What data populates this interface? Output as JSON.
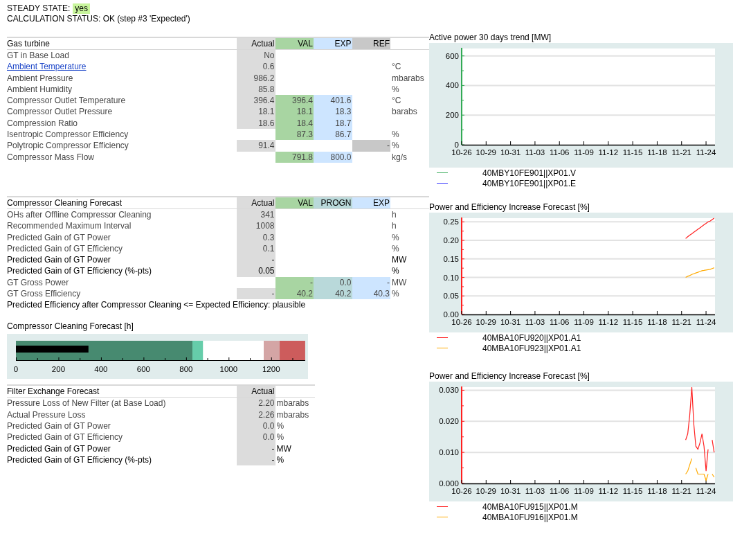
{
  "steady_state": {
    "label": "STEADY STATE:",
    "value": "yes"
  },
  "calculation_status": "CALCULATION STATUS: OK (step #3 'Expected')",
  "gas_turbine": {
    "title": "Gas turbine",
    "columns": [
      {
        "label": "Actual",
        "kind": "actual"
      },
      {
        "label": "VAL",
        "kind": "val"
      },
      {
        "label": "EXP",
        "kind": "exp"
      },
      {
        "label": "REF",
        "kind": "ref"
      }
    ],
    "rows": [
      {
        "label": "GT in Base Load",
        "link": false,
        "emphasized": false,
        "values": {
          "actual": "No"
        }
      },
      {
        "label": "Ambient Temperature",
        "link": true,
        "emphasized": false,
        "values": {
          "actual": "0.6"
        },
        "unit": "°C"
      },
      {
        "label": "Ambient Pressure",
        "link": false,
        "emphasized": false,
        "values": {
          "actual": "986.2"
        },
        "unit": "mbarabs"
      },
      {
        "label": "Ambient Humidity",
        "link": false,
        "emphasized": false,
        "values": {
          "actual": "85.8"
        },
        "unit": "%"
      },
      {
        "label": "Compressor Outlet Temperature",
        "link": false,
        "emphasized": false,
        "values": {
          "actual": "396.4",
          "val": "396.4",
          "exp": "401.6"
        },
        "unit": "°C"
      },
      {
        "label": "Compressor Outlet Pressure",
        "link": false,
        "emphasized": false,
        "values": {
          "actual": "18.1",
          "val": "18.1",
          "exp": "18.3"
        },
        "unit": "barabs"
      },
      {
        "label": "Compression Ratio",
        "link": false,
        "emphasized": false,
        "values": {
          "actual": "18.6",
          "val": "18.4",
          "exp": "18.7"
        }
      },
      {
        "label": "Isentropic Compressor Efficiency",
        "link": false,
        "emphasized": false,
        "values": {
          "val": "87.3",
          "exp": "86.7"
        },
        "unit": "%"
      },
      {
        "label": "Polytropic Compressor Efficiency",
        "link": false,
        "emphasized": false,
        "values": {
          "actual": "91.4",
          "ref": "-"
        },
        "unit": "%"
      },
      {
        "label": "Compressor Mass Flow",
        "link": false,
        "emphasized": false,
        "values": {
          "val": "791.8",
          "exp": "800.0"
        },
        "unit": "kg/s"
      }
    ]
  },
  "compressor_cleaning": {
    "title": "Compressor Cleaning Forecast",
    "columns": [
      {
        "label": "Actual",
        "kind": "actual"
      },
      {
        "label": "VAL",
        "kind": "val"
      },
      {
        "label": "PROGN",
        "kind": "progn"
      },
      {
        "label": "EXP",
        "kind": "exp"
      }
    ],
    "rows": [
      {
        "label": "OHs after Offline Compressor Cleaning",
        "emphasized": false,
        "values": {
          "actual": "341"
        },
        "unit": "h"
      },
      {
        "label": "Recommended Maximum Interval",
        "emphasized": false,
        "values": {
          "actual": "1008"
        },
        "unit": "h"
      },
      {
        "label": "Predicted Gain of GT Power",
        "emphasized": false,
        "values": {
          "actual": "0.3"
        },
        "unit": "%"
      },
      {
        "label": "Predicted Gain of GT Efficiency",
        "emphasized": false,
        "values": {
          "actual": "0.1"
        },
        "unit": "%"
      },
      {
        "label": "Predicted Gain of GT Power",
        "emphasized": true,
        "values": {
          "actual": "-"
        },
        "unit": "MW"
      },
      {
        "label": "Predicted Gain of GT Efficiency (%-pts)",
        "emphasized": true,
        "values": {
          "actual": "0.05"
        },
        "unit": "%"
      },
      {
        "label": "GT Gross Power",
        "emphasized": false,
        "values": {
          "val": "-",
          "progn": "0.0",
          "exp": "-"
        },
        "unit": "MW"
      },
      {
        "label": "GT Gross Efficiency",
        "emphasized": false,
        "values": {
          "actual": "-",
          "val": "40.2",
          "progn": "40.2",
          "exp": "40.3"
        },
        "unit": "%"
      }
    ],
    "note": "Predicted Efficiency after Compressor Cleaning <= Expected Efficiency: plausible"
  },
  "cleaning_forecast_chart": {
    "chart_data": {
      "type": "bar",
      "orientation": "horizontal",
      "title": "Compressor Cleaning Forecast [h]",
      "xlim": [
        0,
        1360
      ],
      "xticks": [
        0,
        200,
        400,
        600,
        800,
        1000,
        1200
      ],
      "series": [
        {
          "color": "#000000",
          "values": [
            341
          ]
        }
      ]
    }
  },
  "filter_exchange": {
    "title": "Filter Exchange Forecast",
    "columns": [
      {
        "label": "Actual",
        "kind": "actual"
      }
    ],
    "rows": [
      {
        "label": "Pressure Loss of New Filter (at Base Load)",
        "emphasized": false,
        "values": {
          "actual": "2.20"
        },
        "unit": "mbarabs"
      },
      {
        "label": "Actual Pressure Loss",
        "emphasized": false,
        "values": {
          "actual": "2.26"
        },
        "unit": "mbarabs"
      },
      {
        "label": "Predicted Gain of GT Power",
        "emphasized": false,
        "values": {
          "actual": "0.0"
        },
        "unit": "%"
      },
      {
        "label": "Predicted Gain of GT Efficiency",
        "emphasized": false,
        "values": {
          "actual": "0.0"
        },
        "unit": "%"
      },
      {
        "label": "Predicted Gain of GT Power",
        "emphasized": true,
        "values": {
          "actual": "-"
        },
        "unit": "MW"
      },
      {
        "label": "Predicted Gain of GT Efficiency (%-pts)",
        "emphasized": true,
        "values": {
          "actual": "-"
        },
        "unit": "%"
      }
    ]
  },
  "trend_charts": [
    {
      "chart_data": {
        "type": "line",
        "title": "Active power 30 days trend [MW]",
        "grid": true,
        "ylim": [
          0,
          650
        ],
        "yticks": [
          0,
          200,
          400,
          600
        ],
        "categories": [
          "10-26",
          null,
          null,
          null,
          null,
          null,
          null,
          null,
          null,
          null,
          null,
          null,
          "10-29",
          null,
          null,
          null,
          null,
          null,
          null,
          null,
          null,
          null,
          null,
          null,
          "10-31",
          null,
          null,
          null,
          null,
          null,
          null,
          null,
          null,
          null,
          null,
          null,
          "11-03",
          null,
          null,
          null,
          null,
          null,
          null,
          null,
          null,
          null,
          null,
          null,
          "11-06",
          null,
          null,
          null,
          null,
          null,
          null,
          null,
          null,
          null,
          null,
          null,
          "11-09",
          null,
          null,
          null,
          null,
          null,
          null,
          null,
          null,
          null,
          null,
          null,
          "11-12",
          null,
          null,
          null,
          null,
          null,
          null,
          null,
          null,
          null,
          null,
          null,
          "11-15",
          null,
          null,
          null,
          null,
          null,
          null,
          null,
          null,
          null,
          null,
          null,
          "11-18",
          null,
          null,
          null,
          null,
          null,
          null,
          null,
          null,
          null,
          null,
          null,
          "11-21",
          null,
          null,
          null,
          null,
          null,
          null,
          null,
          null,
          null,
          null,
          null,
          "11-24",
          null,
          null,
          null,
          null
        ],
        "series": [
          {
            "name": "40MBY10FE901||XP01.V",
            "color": "#33aa55",
            "values": [
              null,
              null,
              null,
              null,
              null,
              null,
              null,
              null,
              null,
              null,
              null,
              null,
              null,
              null,
              null,
              null,
              null,
              null,
              null,
              null,
              null,
              null,
              null,
              null,
              null,
              null,
              null,
              null,
              null,
              null,
              null,
              null,
              null,
              null,
              null,
              null,
              null,
              null,
              null,
              null,
              null,
              null,
              null,
              null,
              null,
              null,
              null,
              null,
              null,
              null,
              null,
              null,
              null,
              null,
              null,
              null,
              null,
              null,
              null,
              null,
              null,
              null,
              null,
              null,
              null,
              null,
              null,
              null,
              null,
              null,
              null,
              null,
              null,
              null,
              null,
              null,
              null,
              null,
              null,
              null,
              null,
              null,
              null,
              null,
              null,
              null,
              null,
              null,
              null,
              null,
              null,
              null,
              null,
              null,
              null,
              null,
              null,
              null,
              null,
              null,
              null,
              null,
              null,
              null,
              null,
              null,
              null,
              null,
              null,
              null,
              null,
              null,
              null,
              null,
              null,
              null,
              null,
              null,
              null,
              null,
              null,
              null,
              null,
              null,
              null
            ]
          },
          {
            "name": "40MBY10FE901||XP01.E",
            "color": "#3333ff",
            "values": [
              null,
              null,
              null,
              null,
              null,
              null,
              null,
              null,
              null,
              null,
              null,
              null,
              null,
              null,
              null,
              null,
              null,
              null,
              null,
              null,
              null,
              null,
              null,
              null,
              null,
              null,
              null,
              null,
              null,
              null,
              null,
              null,
              null,
              null,
              null,
              null,
              null,
              null,
              null,
              null,
              null,
              null,
              null,
              null,
              null,
              null,
              null,
              null,
              null,
              null,
              null,
              null,
              null,
              null,
              null,
              null,
              null,
              null,
              null,
              null,
              null,
              null,
              null,
              null,
              null,
              null,
              null,
              null,
              null,
              null,
              null,
              null,
              null,
              null,
              null,
              null,
              null,
              null,
              null,
              null,
              null,
              null,
              null,
              null,
              null,
              null,
              null,
              null,
              null,
              null,
              null,
              null,
              null,
              null,
              null,
              null,
              null,
              null,
              null,
              null,
              null,
              null,
              null,
              null,
              null,
              null,
              null,
              null,
              null,
              null,
              null,
              null,
              null,
              null,
              null,
              null,
              null,
              null,
              null,
              null,
              null,
              null,
              null,
              null,
              null
            ]
          }
        ]
      }
    },
    {
      "chart_data": {
        "type": "line",
        "title": "Power and Efficiency Increase Forecast [%]",
        "grid": true,
        "ylim": [
          0,
          0.26
        ],
        "yticks": [
          {
            "value": 0,
            "label": "0.00"
          },
          {
            "value": 0.05,
            "label": "0.05"
          },
          {
            "value": 0.1,
            "label": "0.10"
          },
          {
            "value": 0.15,
            "label": "0.15"
          },
          {
            "value": 0.2,
            "label": "0.20"
          },
          {
            "value": 0.25,
            "label": "0.25"
          }
        ],
        "categories": [
          "10-26",
          null,
          null,
          null,
          null,
          null,
          null,
          null,
          null,
          null,
          null,
          null,
          "10-29",
          null,
          null,
          null,
          null,
          null,
          null,
          null,
          null,
          null,
          null,
          null,
          "10-31",
          null,
          null,
          null,
          null,
          null,
          null,
          null,
          null,
          null,
          null,
          null,
          "11-03",
          null,
          null,
          null,
          null,
          null,
          null,
          null,
          null,
          null,
          null,
          null,
          "11-06",
          null,
          null,
          null,
          null,
          null,
          null,
          null,
          null,
          null,
          null,
          null,
          "11-09",
          null,
          null,
          null,
          null,
          null,
          null,
          null,
          null,
          null,
          null,
          null,
          "11-12",
          null,
          null,
          null,
          null,
          null,
          null,
          null,
          null,
          null,
          null,
          null,
          "11-15",
          null,
          null,
          null,
          null,
          null,
          null,
          null,
          null,
          null,
          null,
          null,
          "11-18",
          null,
          null,
          null,
          null,
          null,
          null,
          null,
          null,
          null,
          null,
          null,
          "11-21",
          null,
          null,
          null,
          null,
          null,
          null,
          null,
          null,
          null,
          null,
          null,
          "11-24",
          null,
          null,
          null,
          null
        ],
        "series": [
          {
            "name": "40MBA10FU920||XP01.A1",
            "color": "#ff2020",
            "values": [
              null,
              null,
              null,
              null,
              null,
              null,
              null,
              null,
              null,
              null,
              null,
              null,
              null,
              null,
              null,
              null,
              null,
              null,
              null,
              null,
              null,
              null,
              null,
              null,
              null,
              null,
              null,
              null,
              null,
              null,
              null,
              null,
              null,
              null,
              null,
              null,
              null,
              null,
              null,
              null,
              null,
              null,
              null,
              null,
              null,
              null,
              null,
              null,
              null,
              null,
              null,
              null,
              null,
              null,
              null,
              null,
              null,
              null,
              null,
              null,
              null,
              null,
              null,
              null,
              null,
              null,
              null,
              null,
              null,
              null,
              null,
              null,
              null,
              null,
              null,
              null,
              null,
              null,
              null,
              null,
              null,
              null,
              null,
              null,
              null,
              null,
              null,
              null,
              null,
              null,
              null,
              null,
              null,
              null,
              null,
              null,
              null,
              null,
              null,
              null,
              null,
              null,
              null,
              null,
              null,
              null,
              null,
              null,
              null,
              null,
              0.205,
              0.21,
              0.214,
              0.218,
              0.222,
              0.226,
              0.23,
              0.234,
              0.238,
              0.242,
              0.246,
              0.25,
              0.252,
              0.256,
              0.26
            ]
          },
          {
            "name": "40MBA10FU923||XP01.A1",
            "color": "#ffaa00",
            "values": [
              null,
              null,
              null,
              null,
              null,
              null,
              null,
              null,
              null,
              null,
              null,
              null,
              null,
              null,
              null,
              null,
              null,
              null,
              null,
              null,
              null,
              null,
              null,
              null,
              null,
              null,
              null,
              null,
              null,
              null,
              null,
              null,
              null,
              null,
              null,
              null,
              null,
              null,
              null,
              null,
              null,
              null,
              null,
              null,
              null,
              null,
              null,
              null,
              null,
              null,
              null,
              null,
              null,
              null,
              null,
              null,
              null,
              null,
              null,
              null,
              null,
              null,
              null,
              null,
              null,
              null,
              null,
              null,
              null,
              null,
              null,
              null,
              null,
              null,
              null,
              null,
              null,
              null,
              null,
              null,
              null,
              null,
              null,
              null,
              null,
              null,
              null,
              null,
              null,
              null,
              null,
              null,
              null,
              null,
              null,
              null,
              null,
              null,
              null,
              null,
              null,
              null,
              null,
              null,
              null,
              null,
              null,
              null,
              null,
              null,
              0.1,
              0.103,
              0.105,
              0.108,
              0.11,
              0.112,
              0.114,
              0.116,
              0.118,
              0.119,
              0.12,
              0.121,
              0.122,
              0.124,
              0.126
            ]
          }
        ]
      }
    },
    {
      "chart_data": {
        "type": "line",
        "title": "Power and Efficiency Increase Forecast [%]",
        "grid": true,
        "ylim": [
          0,
          0.031
        ],
        "yticks": [
          {
            "value": 0,
            "label": "0.000"
          },
          {
            "value": 0.01,
            "label": "0.010"
          },
          {
            "value": 0.02,
            "label": "0.020"
          },
          {
            "value": 0.03,
            "label": "0.030"
          }
        ],
        "categories": [
          "10-26",
          null,
          null,
          null,
          null,
          null,
          null,
          null,
          null,
          null,
          null,
          null,
          "10-29",
          null,
          null,
          null,
          null,
          null,
          null,
          null,
          null,
          null,
          null,
          null,
          "10-31",
          null,
          null,
          null,
          null,
          null,
          null,
          null,
          null,
          null,
          null,
          null,
          "11-03",
          null,
          null,
          null,
          null,
          null,
          null,
          null,
          null,
          null,
          null,
          null,
          "11-06",
          null,
          null,
          null,
          null,
          null,
          null,
          null,
          null,
          null,
          null,
          null,
          "11-09",
          null,
          null,
          null,
          null,
          null,
          null,
          null,
          null,
          null,
          null,
          null,
          "11-12",
          null,
          null,
          null,
          null,
          null,
          null,
          null,
          null,
          null,
          null,
          null,
          "11-15",
          null,
          null,
          null,
          null,
          null,
          null,
          null,
          null,
          null,
          null,
          null,
          "11-18",
          null,
          null,
          null,
          null,
          null,
          null,
          null,
          null,
          null,
          null,
          null,
          "11-21",
          null,
          null,
          null,
          null,
          null,
          null,
          null,
          null,
          null,
          null,
          null,
          "11-24",
          null,
          null,
          null,
          null
        ],
        "series": [
          {
            "name": "40MBA10FU915||XP01.M",
            "color": "#ff2020",
            "values": [
              null,
              null,
              null,
              null,
              null,
              null,
              null,
              null,
              null,
              null,
              null,
              null,
              null,
              null,
              null,
              null,
              null,
              null,
              null,
              null,
              null,
              null,
              null,
              null,
              null,
              null,
              null,
              null,
              null,
              null,
              null,
              null,
              null,
              null,
              null,
              null,
              null,
              null,
              null,
              null,
              null,
              null,
              null,
              null,
              null,
              null,
              null,
              null,
              null,
              null,
              null,
              null,
              null,
              null,
              null,
              null,
              null,
              null,
              null,
              null,
              null,
              null,
              null,
              null,
              null,
              null,
              null,
              null,
              null,
              null,
              null,
              null,
              null,
              null,
              null,
              null,
              null,
              null,
              null,
              null,
              null,
              null,
              null,
              null,
              null,
              null,
              null,
              null,
              null,
              null,
              null,
              null,
              null,
              null,
              null,
              null,
              null,
              null,
              null,
              null,
              null,
              null,
              null,
              null,
              null,
              null,
              null,
              null,
              null,
              null,
              0.014,
              0.016,
              0.022,
              0.031,
              0.019,
              0.012,
              0.011,
              0.013,
              0.016,
              0.012,
              0.004,
              0.011,
              null,
              0.014,
              0.01
            ]
          },
          {
            "name": "40MBA10FU916||XP01.M",
            "color": "#ffaa00",
            "values": [
              null,
              null,
              null,
              null,
              null,
              null,
              null,
              null,
              null,
              null,
              null,
              null,
              null,
              null,
              null,
              null,
              null,
              null,
              null,
              null,
              null,
              null,
              null,
              null,
              null,
              null,
              null,
              null,
              null,
              null,
              null,
              null,
              null,
              null,
              null,
              null,
              null,
              null,
              null,
              null,
              null,
              null,
              null,
              null,
              null,
              null,
              null,
              null,
              null,
              null,
              null,
              null,
              null,
              null,
              null,
              null,
              null,
              null,
              null,
              null,
              null,
              null,
              null,
              null,
              null,
              null,
              null,
              null,
              null,
              null,
              null,
              null,
              null,
              null,
              null,
              null,
              null,
              null,
              null,
              null,
              null,
              null,
              null,
              null,
              null,
              null,
              null,
              null,
              null,
              null,
              null,
              null,
              null,
              null,
              null,
              null,
              null,
              null,
              null,
              null,
              null,
              null,
              null,
              null,
              null,
              null,
              null,
              null,
              null,
              null,
              0.003,
              0.004,
              0.006,
              0.008,
              null,
              0.005,
              0.003,
              0.003,
              0.003,
              0.003,
              0.001,
              0.003,
              null,
              0.003,
              0.002
            ]
          }
        ]
      }
    }
  ]
}
